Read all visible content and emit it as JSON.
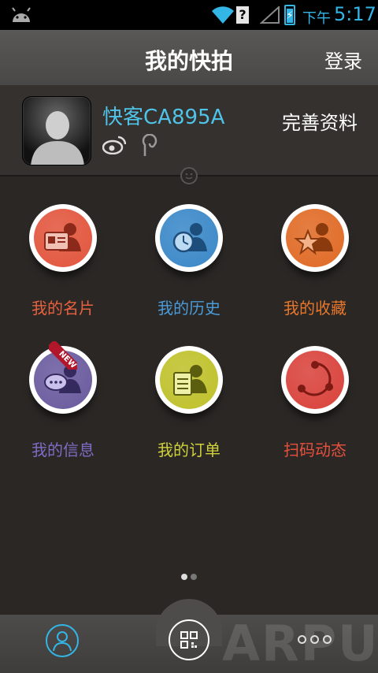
{
  "status_bar": {
    "ampm": "下午",
    "time": "5:17",
    "unknown_glyph": "?"
  },
  "header": {
    "title": "我的快拍",
    "login_label": "登录"
  },
  "profile": {
    "username": "快客CA895A",
    "complete_label": "完善资料"
  },
  "grid": {
    "items": [
      {
        "label": "我的名片",
        "color": "#e2553d",
        "label_color": "#e8613f",
        "icon": "business-card-icon"
      },
      {
        "label": "我的历史",
        "color": "#3a88c8",
        "label_color": "#4a9bd8",
        "icon": "history-clock-icon"
      },
      {
        "label": "我的收藏",
        "color": "#e06a25",
        "label_color": "#e8772b",
        "icon": "favorite-star-icon"
      },
      {
        "label": "我的信息",
        "color": "#6a5a9e",
        "label_color": "#7f6cc4",
        "icon": "message-bubble-icon",
        "badge": "NEW"
      },
      {
        "label": "我的订单",
        "color": "#bfc12b",
        "label_color": "#cfd13a",
        "icon": "order-clipboard-icon"
      },
      {
        "label": "扫码动态",
        "color": "#d9423b",
        "label_color": "#e6503e",
        "icon": "share-network-icon"
      }
    ]
  },
  "pager": {
    "count": 2,
    "active": 0
  },
  "bottom_nav": {
    "watermark": "ARPUN"
  },
  "colors": {
    "accent": "#33b5e5",
    "background": "#2a2725"
  }
}
